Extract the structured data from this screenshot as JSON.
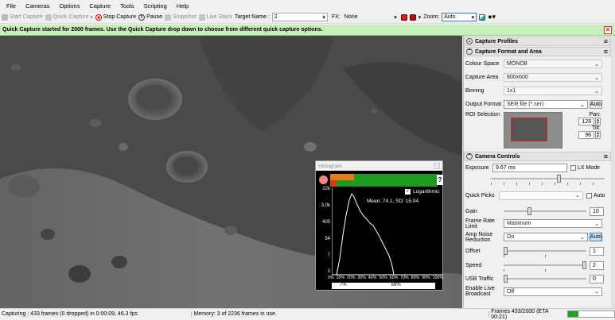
{
  "menu": [
    "File",
    "Cameras",
    "Options",
    "Capture",
    "Tools",
    "Scripting",
    "Help"
  ],
  "toolbar": {
    "start_capture": "Start Capture",
    "quick_capture": "Quick Capture",
    "stop_capture": "Stop Capture",
    "pause": "Pause",
    "snapshot": "Snapshot",
    "live_stack": "Live Stack",
    "target_name_label": "Target Name :",
    "target_name_value": "2",
    "fx_label": "FX:",
    "fx_value": "None",
    "zoom_label": "Zoom:",
    "zoom_value": "Auto"
  },
  "notification": "Quick Capture started for 2000 frames. Use the Quick Capture drop down to choose from different quick capture options.",
  "panel": {
    "capture_profiles": "Capture Profiles",
    "capture_format_area": "Capture Format and Area",
    "colour_space_label": "Colour Space",
    "colour_space_value": "MONO8",
    "capture_area_label": "Capture Area",
    "capture_area_value": "800x600",
    "binning_label": "Binning",
    "binning_value": "1x1",
    "output_format_label": "Output Format",
    "output_format_value": "SER file (*.ser)",
    "auto": "Auto",
    "roi_label": "ROI Selection",
    "pan_label": "Pan:",
    "pan_value": "128",
    "tilt_label": "Tilt:",
    "tilt_value": "96",
    "camera_controls": "Camera Controls",
    "exposure_label": "Exposure",
    "exposure_value": "9.67 ms",
    "lx_mode": "LX Mode",
    "quick_picks_label": "Quick Picks",
    "gain_label": "Gain",
    "gain_value": "10",
    "gain_level": 0.3,
    "frame_rate_label": "Frame Rate Limit",
    "frame_rate_value": "Maximum",
    "amp_noise_label": "Amp Noise Reduction",
    "amp_noise_value": "On",
    "offset_label": "Offset",
    "offset_value": "1",
    "offset_level": 0.0,
    "speed_label": "Speed",
    "speed_value": "2",
    "speed_level": 1.0,
    "usb_label": "USB Traffic",
    "usb_value": "0",
    "usb_level": 0.0,
    "enable_live_label": "Enable Live Broadcast",
    "enable_live_value": "Off"
  },
  "histogram": {
    "title": "Histogram",
    "logarithmic": "Logarithmic",
    "help": "?",
    "stats": "Mean: 74.1, SD: 15.04",
    "y_ticks": [
      "22k",
      "3.0k",
      "400",
      "54",
      "7",
      "1"
    ],
    "x_ticks": [
      "0%",
      "10%",
      "20%",
      "30%",
      "40%",
      "50%",
      "60%",
      "70%",
      "80%",
      "90%",
      "100%"
    ],
    "low_pct": "7%",
    "high_pct": "59%"
  },
  "status": {
    "capturing": "Capturing : 433 frames (0 dropped) in 0:00:09, 46.3 fps",
    "memory": "Memory: 3 of 2236 frames in use.",
    "frames": "Frames 433/2000 (ETA 00:21)",
    "progress": 0.2165
  },
  "colors": {
    "accent_green": "#1fa31f",
    "notify_bg": "#c7efb9",
    "roi_red": "#d42020"
  }
}
